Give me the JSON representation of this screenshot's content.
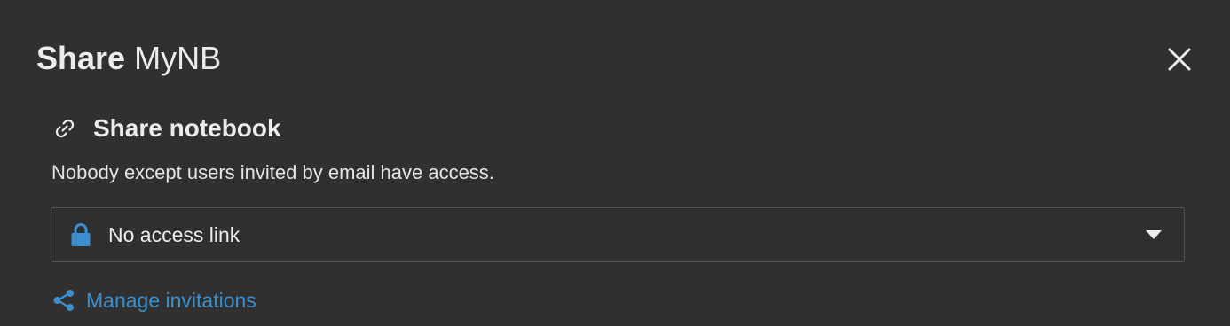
{
  "dialog": {
    "title_strong": "Share",
    "title_name": "MyNB",
    "close_icon": "close-icon"
  },
  "section": {
    "icon": "link-icon",
    "title": "Share notebook",
    "description": "Nobody except users invited by email have access."
  },
  "access_select": {
    "icon": "lock-icon",
    "value": "No access link",
    "caret_icon": "caret-down-icon"
  },
  "manage": {
    "icon": "share-icon",
    "label": "Manage invitations"
  },
  "colors": {
    "background": "#303030",
    "text": "#ececec",
    "accent": "#3b8fcc",
    "border": "#565656"
  }
}
